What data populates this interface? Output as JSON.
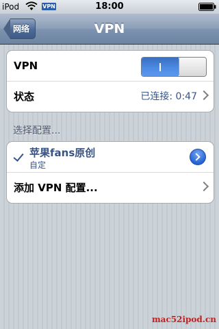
{
  "status_bar": {
    "carrier": "iPod",
    "vpn_badge": "VPN",
    "time": "18:00"
  },
  "nav": {
    "back_label": "网络",
    "title": "VPN"
  },
  "vpn_group": {
    "vpn_label": "VPN",
    "toggle_state": "on",
    "status_label": "状态",
    "status_value": "已连接: 0:47"
  },
  "config_section": {
    "header": "选择配置...",
    "configs": [
      {
        "name": "苹果fans原创",
        "subtitle": "自定",
        "selected": true
      }
    ],
    "add_label": "添加 VPN 配置..."
  },
  "watermark": "mac52ipod.cn",
  "colors": {
    "accent_blue": "#385487",
    "toggle_on": "#4c8ae4",
    "nav_bar": "#7d93b0",
    "background": "#c5ccd4"
  },
  "icons": [
    "wifi-icon",
    "battery-icon",
    "back-arrow-icon",
    "chevron-right-icon",
    "checkmark-icon",
    "detail-disclosure-icon"
  ]
}
